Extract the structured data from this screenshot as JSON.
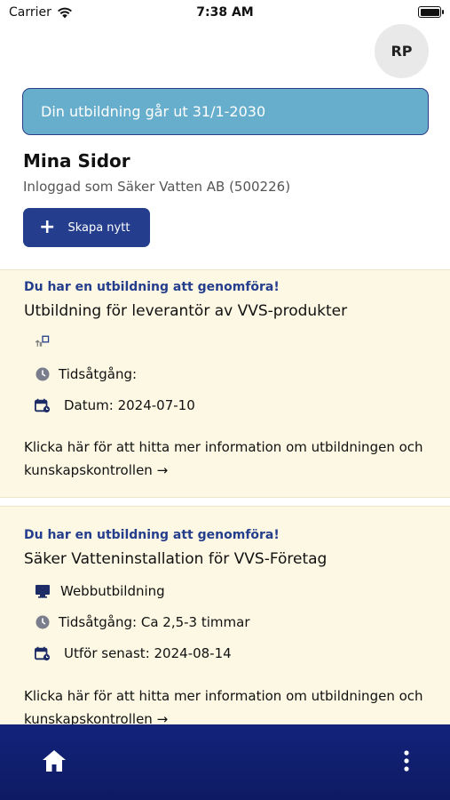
{
  "status_bar": {
    "carrier": "Carrier",
    "time": "7:38 AM"
  },
  "header": {
    "avatar_initials": "RP"
  },
  "banner": {
    "text": "Din utbildning går ut 31/1-2030"
  },
  "page": {
    "title": "Mina Sidor",
    "logged_in_as": "Inloggad som Säker Vatten AB (500226)"
  },
  "create_button": {
    "label": "Skapa nytt"
  },
  "cards": [
    {
      "kicker": "Du har en utbildning att genomföra!",
      "title": "Utbildning för leverantör av VVS-produkter",
      "type_label": "",
      "duration": "Tidsåtgång:",
      "date": "Datum: 2024-07-10",
      "link_line1": "Klicka här för att hitta mer information om utbildningen och",
      "link_line2": "kunskapskontrollen →"
    },
    {
      "kicker": "Du har en utbildning att genomföra!",
      "title": "Säker Vatteninstallation för VVS-Företag",
      "type_label": "Webbutbildning",
      "duration": "Tidsåtgång: Ca 2,5-3 timmar",
      "date": "Utför senast: 2024-08-14",
      "link_line1": "Klicka här för att hitta mer information om utbildningen och",
      "link_line2": "kunskapskontrollen →"
    }
  ],
  "colors": {
    "brand": "#243d8c",
    "banner": "#67aecd",
    "card_bg": "#fcf8e3",
    "nav_bg": "#13237a"
  },
  "nav": {
    "home_icon": "home-icon",
    "more_icon": "more-vertical-icon"
  }
}
